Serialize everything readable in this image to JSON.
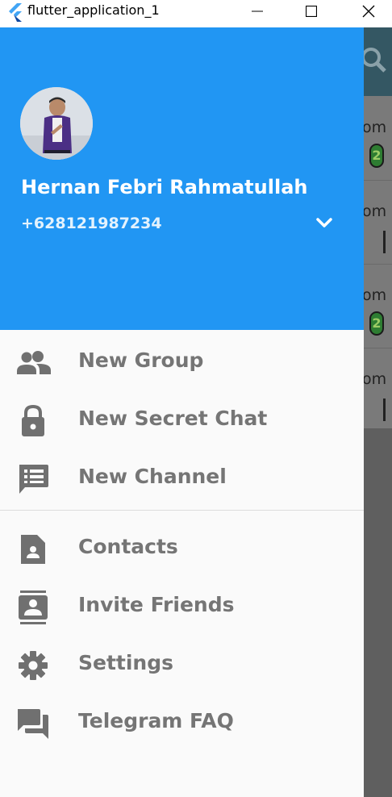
{
  "window": {
    "title": "flutter_application_1",
    "icons": {
      "logo": "flutter-logo-icon",
      "minimize": "minimize-icon",
      "maximize": "maximize-icon",
      "close": "close-icon"
    }
  },
  "drawer": {
    "user": {
      "name": "Hernan Febri Rahmatullah",
      "phone": "+628121987234"
    },
    "header_color": "#2196f3",
    "menu": [
      {
        "label": "New Group",
        "icon": "group-icon"
      },
      {
        "label": "New Secret Chat",
        "icon": "lock-icon"
      },
      {
        "label": "New Channel",
        "icon": "channel-icon"
      },
      {
        "label": "Contacts",
        "icon": "contacts-icon"
      },
      {
        "label": "Invite Friends",
        "icon": "invite-friends-icon"
      },
      {
        "label": "Settings",
        "icon": "gear-icon"
      },
      {
        "label": "Telegram FAQ",
        "icon": "faq-icon"
      }
    ]
  },
  "background_list": {
    "time_fragments": [
      "om",
      "om",
      "om",
      "om"
    ],
    "badges": [
      "2",
      "2"
    ]
  }
}
